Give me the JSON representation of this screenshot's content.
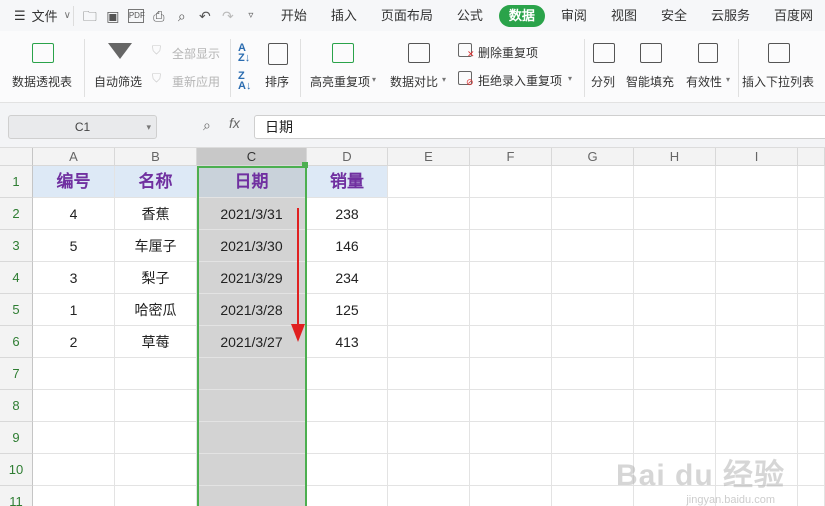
{
  "menubar": {
    "file_label": "文件",
    "tabs": [
      "开始",
      "插入",
      "页面布局",
      "公式",
      "数据",
      "审阅",
      "视图",
      "安全",
      "云服务",
      "百度网"
    ],
    "active_tab": "数据"
  },
  "ribbon": {
    "pivot": "数据透视表",
    "autofilter": "自动筛选",
    "show_all": "全部显示",
    "reapply": "重新应用",
    "sort": "排序",
    "highlight_dup": "高亮重复项",
    "compare": "数据对比",
    "delete_dup": "删除重复项",
    "reject_dup": "拒绝录入重复项",
    "split": "分列",
    "smart_fill": "智能填充",
    "validity": "有效性",
    "insert_dropdown": "插入下拉列表"
  },
  "formula": {
    "cell_ref": "C1",
    "fx": "fx",
    "value": "日期"
  },
  "sheet": {
    "columns": [
      "A",
      "B",
      "C",
      "D",
      "E",
      "F",
      "G",
      "H",
      "I"
    ],
    "rows": [
      "1",
      "2",
      "3",
      "4",
      "5",
      "6",
      "7",
      "8",
      "9",
      "10",
      "11"
    ],
    "header": [
      "编号",
      "名称",
      "日期",
      "销量"
    ],
    "data": [
      [
        "4",
        "香蕉",
        "2021/3/31",
        "238"
      ],
      [
        "5",
        "车厘子",
        "2021/3/30",
        "146"
      ],
      [
        "3",
        "梨子",
        "2021/3/29",
        "234"
      ],
      [
        "1",
        "哈密瓜",
        "2021/3/28",
        "125"
      ],
      [
        "2",
        "草莓",
        "2021/3/27",
        "413"
      ]
    ]
  },
  "colors": {
    "accent": "#2aa34a",
    "selection": "#4caf50",
    "header_text": "#7030a0",
    "arrow": "#e02020"
  },
  "watermark": {
    "logo": "Bai du 经验",
    "url": "jingyan.baidu.com"
  }
}
